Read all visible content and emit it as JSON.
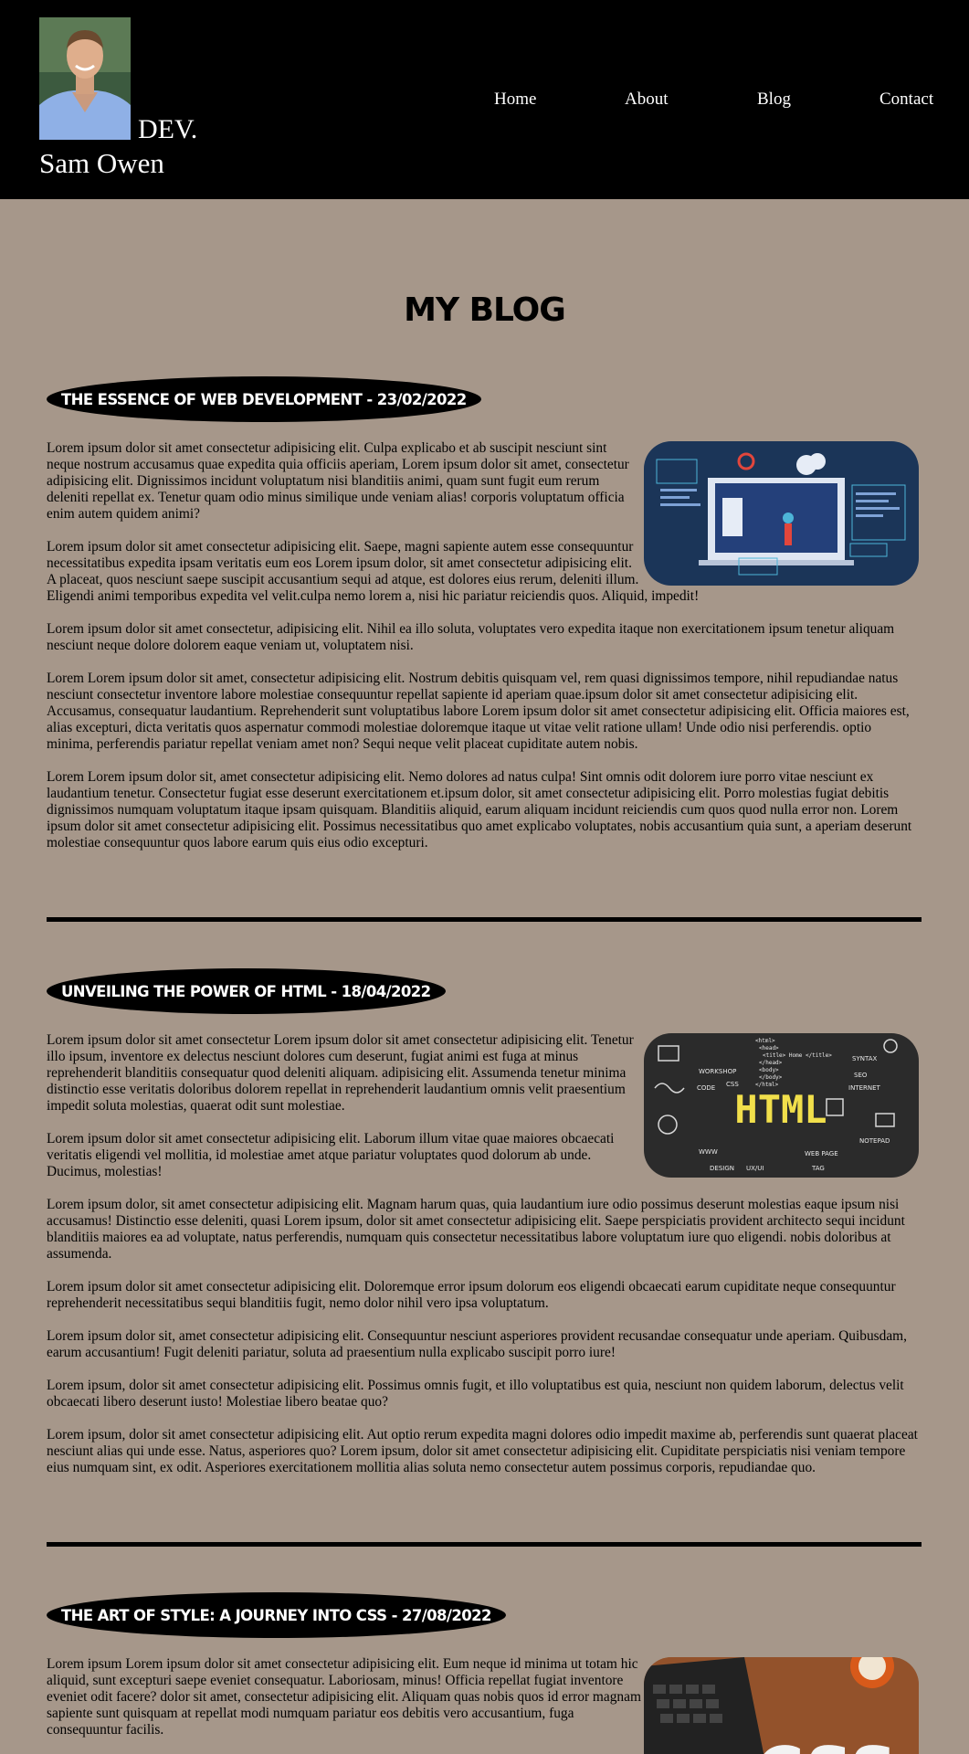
{
  "header": {
    "brand_dev": "DEV.",
    "brand_name": "Sam Owen",
    "nav": [
      "Home",
      "About",
      "Blog",
      "Contact"
    ]
  },
  "page_title": "MY BLOG",
  "posts": [
    {
      "title": "THE ESSENCE OF WEB DEVELOPMENT - 23/02/2022",
      "paragraphs": [
        "Lorem ipsum dolor sit amet consectetur adipisicing elit. Culpa explicabo et ab suscipit nesciunt sint neque nostrum accusamus quae expedita quia officiis aperiam, Lorem ipsum dolor sit amet, consectetur adipisicing elit. Dignissimos incidunt voluptatum nisi blanditiis animi, quam sunt fugit eum rerum deleniti repellat ex. Tenetur quam odio minus similique unde veniam alias! corporis voluptatum officia enim autem quidem animi?",
        "Lorem ipsum dolor sit amet consectetur adipisicing elit. Saepe, magni sapiente autem esse consequuntur necessitatibus expedita ipsam veritatis eum eos Lorem ipsum dolor, sit amet consectetur adipisicing elit. A placeat, quos nesciunt saepe suscipit accusantium sequi ad atque, est dolores eius rerum, deleniti illum. Eligendi animi temporibus expedita vel velit.culpa nemo lorem a, nisi hic pariatur reiciendis quos. Aliquid, impedit!",
        "Lorem ipsum dolor sit amet consectetur, adipisicing elit. Nihil ea illo soluta, voluptates vero expedita itaque non exercitationem ipsum tenetur aliquam nesciunt neque dolore dolorem eaque veniam ut, voluptatem nisi.",
        "Lorem Lorem ipsum dolor sit amet, consectetur adipisicing elit. Nostrum debitis quisquam vel, rem quasi dignissimos tempore, nihil repudiandae natus nesciunt consectetur inventore labore molestiae consequuntur repellat sapiente id aperiam quae.ipsum dolor sit amet consectetur adipisicing elit. Accusamus, consequatur laudantium. Reprehenderit sunt voluptatibus labore Lorem ipsum dolor sit amet consectetur adipisicing elit. Officia maiores est, alias excepturi, dicta veritatis quos aspernatur commodi molestiae doloremque itaque ut vitae velit ratione ullam! Unde odio nisi perferendis. optio minima, perferendis pariatur repellat veniam amet non? Sequi neque velit placeat cupiditate autem nobis.",
        "Lorem Lorem ipsum dolor sit, amet consectetur adipisicing elit. Nemo dolores ad natus culpa! Sint omnis odit dolorem iure porro vitae nesciunt ex laudantium tenetur. Consectetur fugiat esse deserunt exercitationem et.ipsum dolor, sit amet consectetur adipisicing elit. Porro molestias fugiat debitis dignissimos numquam voluptatum itaque ipsam quisquam. Blanditiis aliquid, earum aliquam incidunt reiciendis cum quos quod nulla error non. Lorem ipsum dolor sit amet consectetur adipisicing elit. Possimus necessitatibus quo amet explicabo voluptates, nobis accusantium quia sunt, a aperiam deserunt molestiae consequuntur quos labore earum quis eius odio excepturi."
      ]
    },
    {
      "title": "UNVEILING THE POWER OF HTML - 18/04/2022",
      "image_text": {
        "main": "HTML",
        "labels": [
          "WORKSHOP",
          "CODE",
          "CSS",
          "SYNTAX",
          "SEO",
          "INTERNET",
          "DESIGN",
          "UX/UI",
          "WEB PAGE",
          "TAG",
          "WWW",
          "NOTEPAD",
          "<html>",
          "<head>",
          "<title> Home </title>",
          "</head>",
          "<body>",
          "</body>",
          "</html>"
        ]
      },
      "paragraphs": [
        "Lorem ipsum dolor sit amet consectetur Lorem ipsum dolor sit amet consectetur adipisicing elit. Tenetur illo ipsum, inventore ex delectus nesciunt dolores cum deserunt, fugiat animi est fuga at minus reprehenderit blanditiis consequatur quod deleniti aliquam. adipisicing elit. Assumenda tenetur minima distinctio esse veritatis doloribus dolorem repellat in reprehenderit laudantium omnis velit praesentium impedit soluta molestias, quaerat odit sunt molestiae.",
        "Lorem ipsum dolor sit amet consectetur adipisicing elit. Laborum illum vitae quae maiores obcaecati veritatis eligendi vel mollitia, id molestiae amet atque pariatur voluptates quod dolorum ab unde. Ducimus, molestias!",
        "Lorem ipsum dolor, sit amet consectetur adipisicing elit. Magnam harum quas, quia laudantium iure odio possimus deserunt molestias eaque ipsum nisi accusamus! Distinctio esse deleniti, quasi Lorem ipsum, dolor sit amet consectetur adipisicing elit. Saepe perspiciatis provident architecto sequi incidunt blanditiis maiores ea ad voluptate, natus perferendis, numquam quis consectetur necessitatibus labore voluptatum iure quo eligendi. nobis doloribus at assumenda.",
        "Lorem ipsum dolor sit amet consectetur adipisicing elit. Doloremque error ipsum dolorum eos eligendi obcaecati earum cupiditate neque consequuntur reprehenderit necessitatibus sequi blanditiis fugit, nemo dolor nihil vero ipsa voluptatum.",
        "Lorem ipsum dolor sit, amet consectetur adipisicing elit. Consequuntur nesciunt asperiores provident recusandae consequatur unde aperiam. Quibusdam, earum accusantium! Fugit deleniti pariatur, soluta ad praesentium nulla explicabo suscipit porro iure!",
        "Lorem ipsum, dolor sit amet consectetur adipisicing elit. Possimus omnis fugit, et illo voluptatibus est quia, nesciunt non quidem laborum, delectus velit obcaecati libero deserunt iusto! Molestiae libero beatae quo?",
        "Lorem ipsum, dolor sit amet consectetur adipisicing elit. Aut optio rerum expedita magni dolores odio impedit maxime ab, perferendis sunt quaerat placeat nesciunt alias qui unde esse. Natus, asperiores quo? Lorem ipsum, dolor sit amet consectetur adipisicing elit. Cupiditate perspiciatis nisi veniam tempore eius numquam sint, ex odit. Asperiores exercitationem mollitia alias soluta nemo consectetur autem possimus corporis, repudiandae quo."
      ]
    },
    {
      "title": "THE ART OF STYLE: A JOURNEY INTO CSS - 27/08/2022",
      "image_text": {
        "main": "CSS"
      },
      "paragraphs": [
        "Lorem ipsum Lorem ipsum dolor sit amet consectetur adipisicing elit. Eum neque id minima ut totam hic aliquid, sunt excepturi saepe eveniet consequatur. Laboriosam, minus! Officia repellat fugiat inventore eveniet odit facere? dolor sit amet, consectetur adipisicing elit. Aliquam quas nobis quos id error magnam sapiente sunt quisquam at repellat modi numquam pariatur eos debitis vero accusantium, fuga consequuntur facilis."
      ]
    }
  ]
}
